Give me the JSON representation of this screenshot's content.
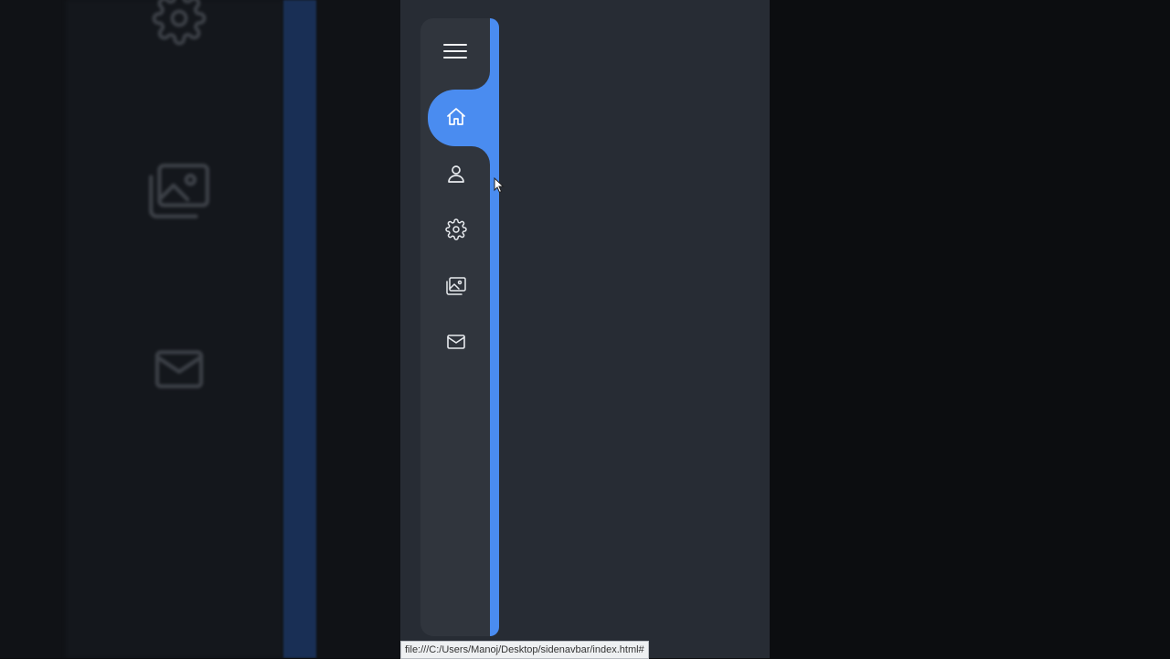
{
  "sidebar": {
    "toggle_icon": "hamburger-menu-icon",
    "accent_color": "#4a8cf0",
    "background_color": "#30353d",
    "active_item": "home",
    "items": [
      {
        "id": "home",
        "icon": "home-icon"
      },
      {
        "id": "profile",
        "icon": "user-icon"
      },
      {
        "id": "settings",
        "icon": "gear-icon"
      },
      {
        "id": "gallery",
        "icon": "image-gallery-icon"
      },
      {
        "id": "messages",
        "icon": "mail-icon"
      }
    ]
  },
  "status_bar": {
    "url": "file:///C:/Users/Manoj/Desktop/sidenavbar/index.html#"
  }
}
